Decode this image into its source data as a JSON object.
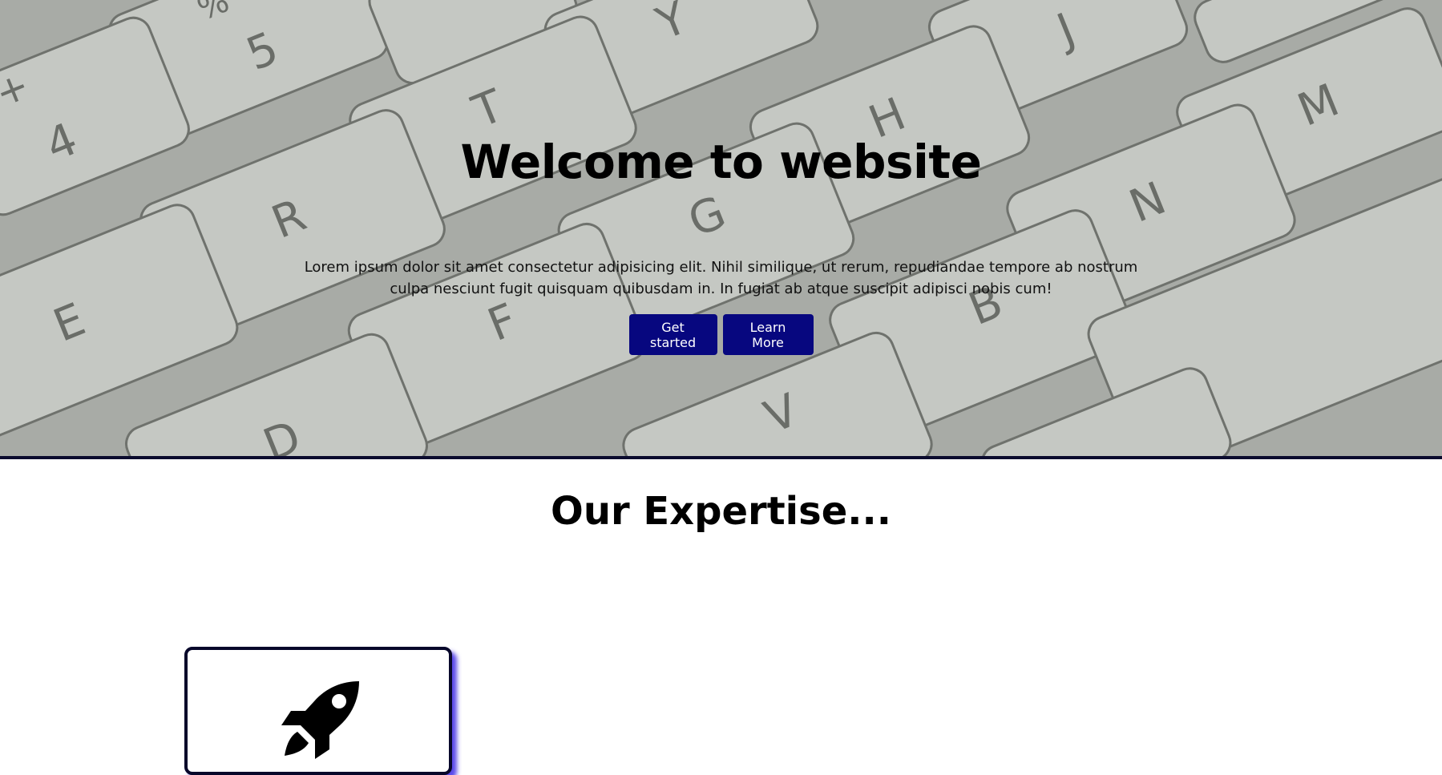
{
  "hero": {
    "title": "Welcome to website",
    "text": "Lorem ipsum dolor sit amet consectetur adipisicing elit. Nihil similique, ut rerum, repudiandae tempore ab nostrum culpa nesciunt fugit quisquam quibusdam in. In fugiat ab atque suscipit adipisci nobis cum!",
    "background": "keyboard-photo",
    "keys": [
      "%",
      "5",
      "4",
      "+",
      "T",
      "Y",
      "J",
      "H",
      "M",
      "N",
      "R",
      "G",
      "E",
      "F",
      "B",
      "D",
      "V"
    ]
  },
  "buttons": {
    "get_started": "Get started",
    "learn_more": "Learn More"
  },
  "expertise": {
    "title": "Our Expertise...",
    "cards": [
      {
        "icon": "rocket-icon"
      }
    ]
  },
  "colors": {
    "button_bg": "#07077f",
    "button_text": "#ffffff",
    "hero_border": "#0b0b2e",
    "card_shadow": "#3c28e6"
  }
}
